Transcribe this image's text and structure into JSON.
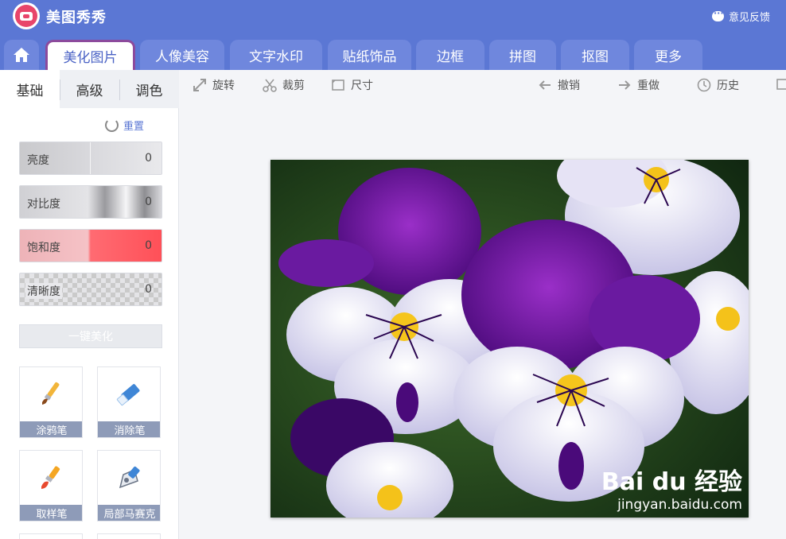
{
  "app": {
    "title": "美图秀秀",
    "feedback_label": "意见反馈"
  },
  "tabs": [
    {
      "label": "美化图片",
      "active": true
    },
    {
      "label": "人像美容"
    },
    {
      "label": "文字水印"
    },
    {
      "label": "贴纸饰品"
    },
    {
      "label": "边框"
    },
    {
      "label": "拼图"
    },
    {
      "label": "抠图"
    },
    {
      "label": "更多"
    }
  ],
  "subtabs": [
    "基础",
    "高级",
    "调色"
  ],
  "reset_label": "重置",
  "adjustments": [
    {
      "label": "亮度",
      "value": "0"
    },
    {
      "label": "对比度",
      "value": "0"
    },
    {
      "label": "饱和度",
      "value": "0"
    },
    {
      "label": "清晰度",
      "value": "0"
    }
  ],
  "one_key_label": "一键美化",
  "tools": [
    {
      "label": "涂鸦笔",
      "icon": "brush-icon"
    },
    {
      "label": "消除笔",
      "icon": "eraser-icon"
    },
    {
      "label": "取样笔",
      "icon": "sampling-brush-icon"
    },
    {
      "label": "局部马赛克",
      "icon": "mosaic-pen-icon"
    }
  ],
  "toolbar": {
    "rotate": "旋转",
    "crop": "裁剪",
    "size": "尺寸",
    "undo": "撤销",
    "redo": "重做",
    "history": "历史"
  },
  "watermark": {
    "brand": "Bai du 经验",
    "url": "jingyan.baidu.com"
  },
  "colors": {
    "header": "#5b77d4",
    "active_tab_border": "#8c4a9c",
    "accent": "#5b77d4",
    "saturation": "#ff5058"
  }
}
